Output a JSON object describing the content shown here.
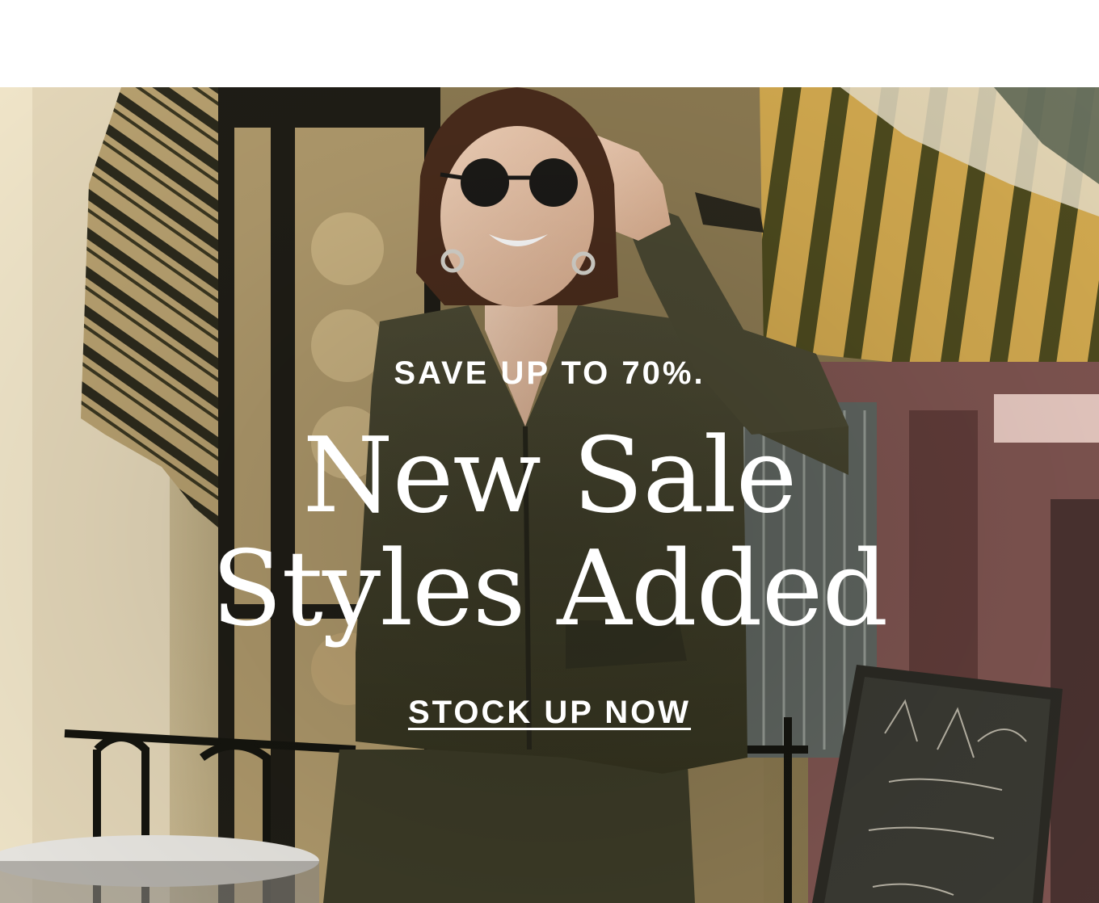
{
  "hero": {
    "eyebrow": "SAVE UP TO 70%.",
    "headline_line1": "New Sale",
    "headline_line2": "Styles Added",
    "cta_label": "STOCK UP NOW"
  },
  "colors": {
    "text": "#ffffff",
    "page_background": "#ffffff"
  }
}
